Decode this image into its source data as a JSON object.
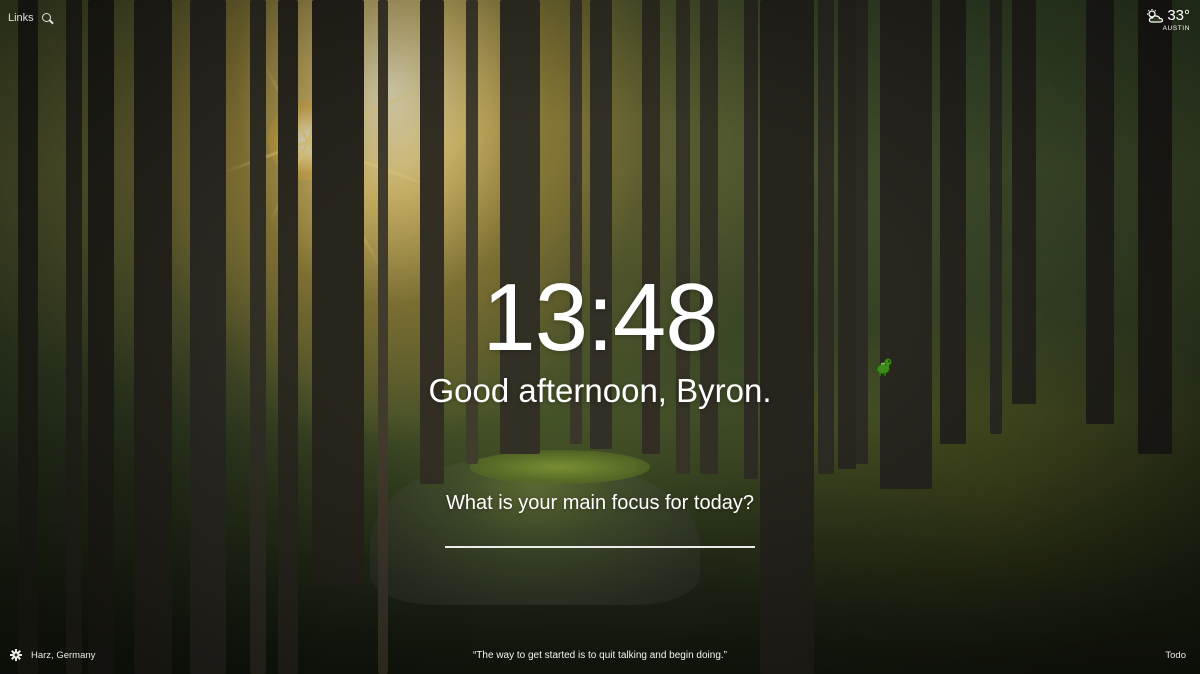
{
  "top_left": {
    "links_label": "Links"
  },
  "weather": {
    "temperature": "33°",
    "location": "AUSTIN",
    "icon": "partly-sunny-icon"
  },
  "main": {
    "clock": "13:48",
    "greeting": "Good afternoon, Byron.",
    "focus_question": "What is your main focus for today?",
    "focus_value": ""
  },
  "footer": {
    "photo_location": "Harz, Germany",
    "quote": "“The way to get started is to quit talking and begin doing.”",
    "todo_label": "Todo"
  }
}
